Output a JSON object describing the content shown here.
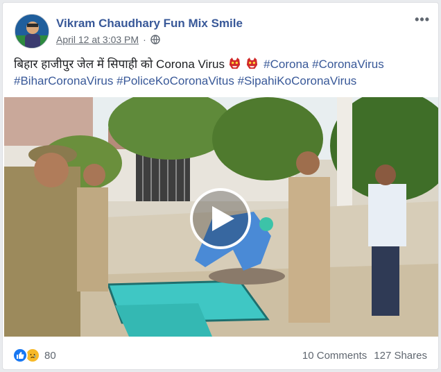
{
  "post": {
    "author": "Vikram Chaudhary Fun Mix Smile",
    "timestamp": "April 12 at 3:03 PM",
    "privacy_icon": "globe-icon",
    "menu_icon": "more-options-icon",
    "caption_text": "बिहार हाजीपुर जेल में सिपाही को Corona Virus",
    "caption_emojis": [
      "ogre-mask-emoji",
      "ogre-mask-emoji"
    ],
    "hashtags": [
      "#Corona",
      "#CoronaVirus",
      "#BiharCoronaVirus",
      "#PoliceKoCoronaVitus",
      "#SipahiKoCoronaVirus"
    ]
  },
  "video": {
    "play_icon": "play-icon"
  },
  "footer": {
    "reaction_icons": [
      "like-reaction-icon",
      "sad-reaction-icon"
    ],
    "reaction_count": "80",
    "comments": "10 Comments",
    "shares": "127 Shares"
  },
  "colors": {
    "link_blue": "#385898",
    "secondary_text": "#606770",
    "like_blue": "#1877f2",
    "sad_yellow": "#f7b928"
  }
}
